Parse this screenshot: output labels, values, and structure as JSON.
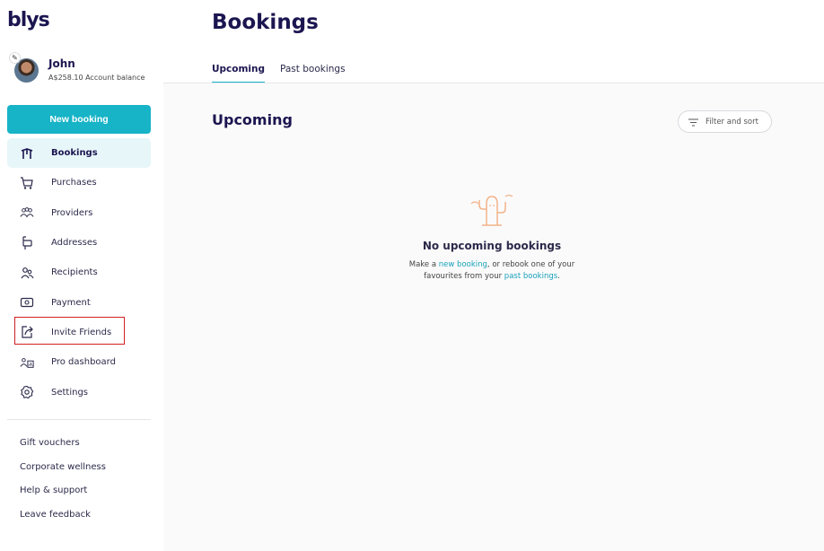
{
  "brand": {
    "logo_text": "blys"
  },
  "user": {
    "name": "John",
    "balance": "A$258.10 Account balance"
  },
  "sidebar": {
    "new_booking_label": "New booking",
    "items": [
      {
        "label": "Bookings",
        "icon": "umbrella-table-icon"
      },
      {
        "label": "Purchases",
        "icon": "cart-icon"
      },
      {
        "label": "Providers",
        "icon": "group-icon"
      },
      {
        "label": "Addresses",
        "icon": "mailbox-icon"
      },
      {
        "label": "Recipients",
        "icon": "people-icon"
      },
      {
        "label": "Payment",
        "icon": "card-icon"
      },
      {
        "label": "Invite Friends",
        "icon": "share-icon"
      },
      {
        "label": "Pro dashboard",
        "icon": "dashboard-icon"
      },
      {
        "label": "Settings",
        "icon": "gear-icon"
      }
    ],
    "footer_links": [
      "Gift vouchers",
      "Corporate wellness",
      "Help & support",
      "Leave feedback"
    ]
  },
  "main": {
    "title": "Bookings",
    "tabs": [
      {
        "label": "Upcoming"
      },
      {
        "label": "Past bookings"
      }
    ],
    "section_title": "Upcoming",
    "filter_label": "Filter and sort",
    "empty": {
      "title": "No upcoming bookings",
      "text_1": "Make a ",
      "link_1": "new booking",
      "text_2": ", or rebook one of your",
      "text_3": "favourites from your ",
      "link_2": "past bookings",
      "text_4": "."
    }
  },
  "colors": {
    "accent": "#17b3c6",
    "navy": "#1b1650",
    "highlight": "#d02020"
  }
}
